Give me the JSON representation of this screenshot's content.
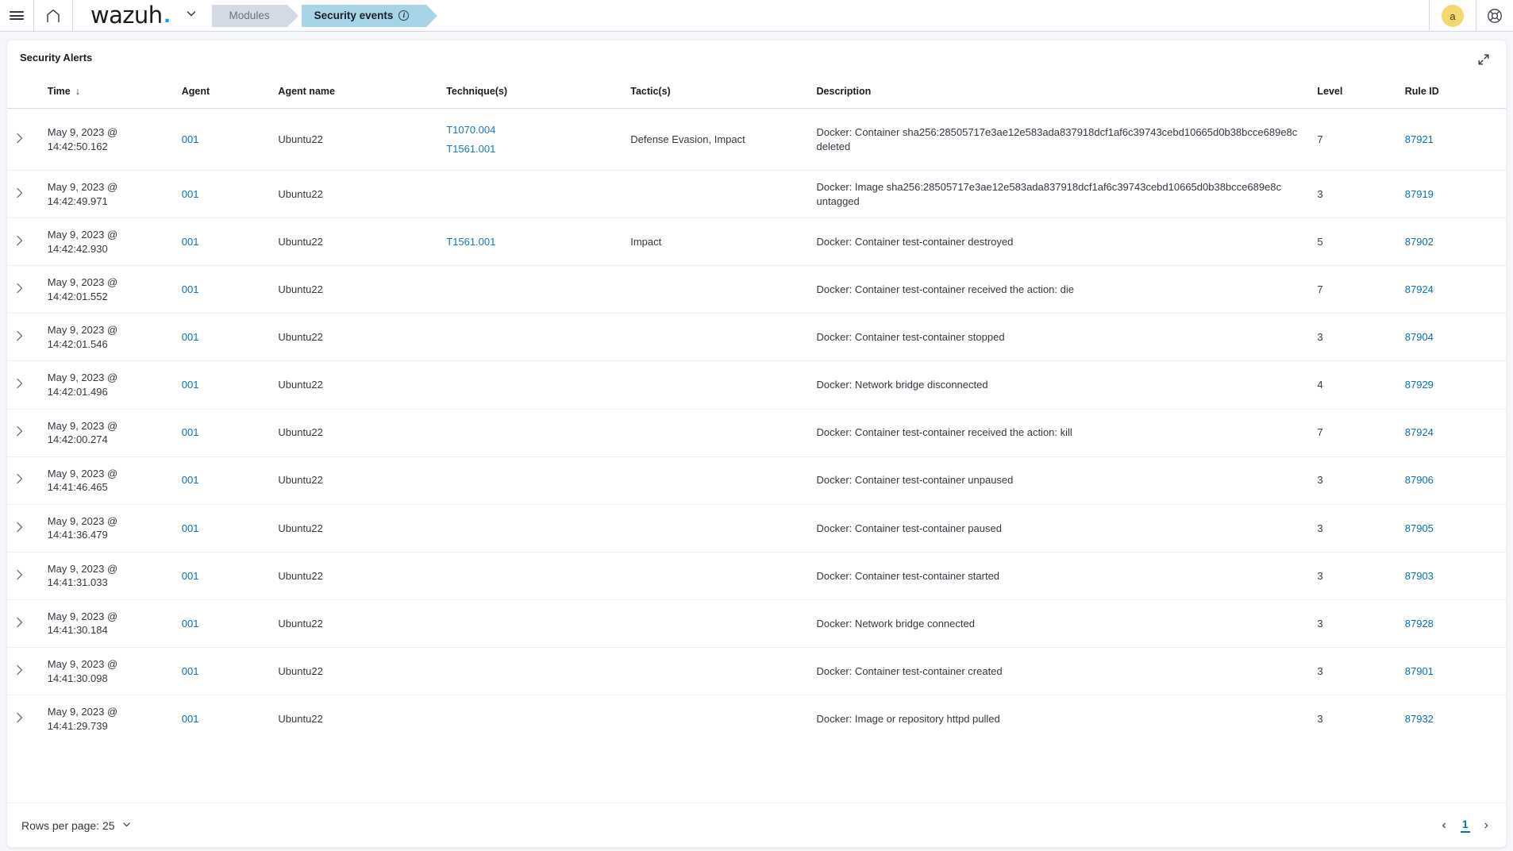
{
  "topbar": {
    "menu_icon": "hamburger-icon",
    "home_icon": "home-icon",
    "brand": "wazuh",
    "brand_dot": ".",
    "brand_caret_icon": "chevron-down-icon",
    "breadcrumbs": [
      {
        "label": "Modules",
        "active": false
      },
      {
        "label": "Security events",
        "active": true,
        "info_icon": "info-icon"
      }
    ],
    "avatar_initial": "a",
    "help_icon": "lifebuoy-icon"
  },
  "panel": {
    "title": "Security Alerts",
    "expand_icon": "expand-icon"
  },
  "table": {
    "columns": [
      {
        "key": "expander",
        "label": ""
      },
      {
        "key": "time",
        "label": "Time",
        "sorted": true,
        "sort_icon": "arrow-down-icon"
      },
      {
        "key": "agent",
        "label": "Agent"
      },
      {
        "key": "agent_name",
        "label": "Agent name"
      },
      {
        "key": "techniques",
        "label": "Technique(s)"
      },
      {
        "key": "tactics",
        "label": "Tactic(s)"
      },
      {
        "key": "description",
        "label": "Description"
      },
      {
        "key": "level",
        "label": "Level"
      },
      {
        "key": "rule_id",
        "label": "Rule ID"
      }
    ],
    "rows": [
      {
        "time": "May 9, 2023 @ 14:42:50.162",
        "agent": "001",
        "agent_name": "Ubuntu22",
        "techniques": [
          "T1070.004",
          "T1561.001"
        ],
        "tactics": "Defense Evasion, Impact",
        "description": "Docker: Container sha256:28505717e3ae12e583ada837918dcf1af6c39743cebd10665d0b38bcce689e8c deleted",
        "level": "7",
        "rule_id": "87921"
      },
      {
        "time": "May 9, 2023 @ 14:42:49.971",
        "agent": "001",
        "agent_name": "Ubuntu22",
        "techniques": [],
        "tactics": "",
        "description": "Docker: Image sha256:28505717e3ae12e583ada837918dcf1af6c39743cebd10665d0b38bcce689e8c untagged",
        "level": "3",
        "rule_id": "87919"
      },
      {
        "time": "May 9, 2023 @ 14:42:42.930",
        "agent": "001",
        "agent_name": "Ubuntu22",
        "techniques": [
          "T1561.001"
        ],
        "tactics": "Impact",
        "description": "Docker: Container test-container destroyed",
        "level": "5",
        "rule_id": "87902"
      },
      {
        "time": "May 9, 2023 @ 14:42:01.552",
        "agent": "001",
        "agent_name": "Ubuntu22",
        "techniques": [],
        "tactics": "",
        "description": "Docker: Container test-container received the action: die",
        "level": "7",
        "rule_id": "87924"
      },
      {
        "time": "May 9, 2023 @ 14:42:01.546",
        "agent": "001",
        "agent_name": "Ubuntu22",
        "techniques": [],
        "tactics": "",
        "description": "Docker: Container test-container stopped",
        "level": "3",
        "rule_id": "87904"
      },
      {
        "time": "May 9, 2023 @ 14:42:01.496",
        "agent": "001",
        "agent_name": "Ubuntu22",
        "techniques": [],
        "tactics": "",
        "description": "Docker: Network bridge disconnected",
        "level": "4",
        "rule_id": "87929"
      },
      {
        "time": "May 9, 2023 @ 14:42:00.274",
        "agent": "001",
        "agent_name": "Ubuntu22",
        "techniques": [],
        "tactics": "",
        "description": "Docker: Container test-container received the action: kill",
        "level": "7",
        "rule_id": "87924"
      },
      {
        "time": "May 9, 2023 @ 14:41:46.465",
        "agent": "001",
        "agent_name": "Ubuntu22",
        "techniques": [],
        "tactics": "",
        "description": "Docker: Container test-container unpaused",
        "level": "3",
        "rule_id": "87906"
      },
      {
        "time": "May 9, 2023 @ 14:41:36.479",
        "agent": "001",
        "agent_name": "Ubuntu22",
        "techniques": [],
        "tactics": "",
        "description": "Docker: Container test-container paused",
        "level": "3",
        "rule_id": "87905"
      },
      {
        "time": "May 9, 2023 @ 14:41:31.033",
        "agent": "001",
        "agent_name": "Ubuntu22",
        "techniques": [],
        "tactics": "",
        "description": "Docker: Container test-container started",
        "level": "3",
        "rule_id": "87903"
      },
      {
        "time": "May 9, 2023 @ 14:41:30.184",
        "agent": "001",
        "agent_name": "Ubuntu22",
        "techniques": [],
        "tactics": "",
        "description": "Docker: Network bridge connected",
        "level": "3",
        "rule_id": "87928"
      },
      {
        "time": "May 9, 2023 @ 14:41:30.098",
        "agent": "001",
        "agent_name": "Ubuntu22",
        "techniques": [],
        "tactics": "",
        "description": "Docker: Container test-container created",
        "level": "3",
        "rule_id": "87901"
      },
      {
        "time": "May 9, 2023 @ 14:41:29.739",
        "agent": "001",
        "agent_name": "Ubuntu22",
        "techniques": [],
        "tactics": "",
        "description": "Docker: Image or repository httpd pulled",
        "level": "3",
        "rule_id": "87932"
      }
    ]
  },
  "footer": {
    "rows_per_page_label": "Rows per page: 25",
    "rows_per_page_caret": "chevron-down-icon",
    "prev_icon": "chevron-left-icon",
    "next_icon": "chevron-right-icon",
    "current_page": "1"
  },
  "colors": {
    "link": "#0a6fb5",
    "tab_active_bg": "#a6d5ea",
    "tab_inactive_bg": "#d3dae6",
    "avatar_bg": "#f5d76e",
    "brand_dot": "#0d9bd4"
  }
}
